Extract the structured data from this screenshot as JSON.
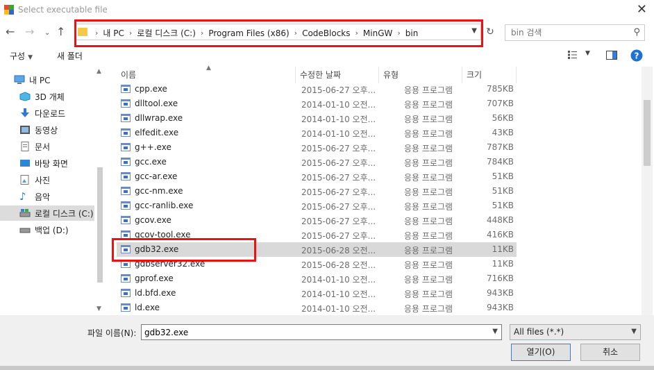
{
  "window": {
    "title": "Select executable file"
  },
  "address": {
    "crumbs": [
      "내 PC",
      "로컬 디스크 (C:)",
      "Program Files (x86)",
      "CodeBlocks",
      "MinGW",
      "bin"
    ]
  },
  "search": {
    "placeholder": "bin 검색"
  },
  "toolbar": {
    "organize_label": "구성",
    "new_folder_label": "새 폴더"
  },
  "sidebar": {
    "items": [
      {
        "label": "내 PC",
        "icon": "pc-icon"
      },
      {
        "label": "3D 개체",
        "icon": "cube-icon"
      },
      {
        "label": "다운로드",
        "icon": "download-icon"
      },
      {
        "label": "동영상",
        "icon": "video-icon"
      },
      {
        "label": "문서",
        "icon": "document-icon"
      },
      {
        "label": "바탕 화면",
        "icon": "desktop-icon"
      },
      {
        "label": "사진",
        "icon": "picture-icon"
      },
      {
        "label": "음악",
        "icon": "music-icon"
      },
      {
        "label": "로컬 디스크 (C:)",
        "icon": "drive-icon"
      },
      {
        "label": "백업 (D:)",
        "icon": "drive-icon"
      }
    ],
    "selected": "로컬 디스크 (C:)"
  },
  "columns": {
    "name": "이름",
    "date": "수정한 날짜",
    "type": "유형",
    "size": "크기"
  },
  "files": [
    {
      "name": "cpp.exe",
      "date": "2015-06-27 오후...",
      "type": "응용 프로그램",
      "size": "785KB"
    },
    {
      "name": "dlltool.exe",
      "date": "2014-01-10 오전...",
      "type": "응용 프로그램",
      "size": "707KB"
    },
    {
      "name": "dllwrap.exe",
      "date": "2014-01-10 오전...",
      "type": "응용 프로그램",
      "size": "56KB"
    },
    {
      "name": "elfedit.exe",
      "date": "2014-01-10 오전...",
      "type": "응용 프로그램",
      "size": "43KB"
    },
    {
      "name": "g++.exe",
      "date": "2015-06-27 오후...",
      "type": "응용 프로그램",
      "size": "787KB"
    },
    {
      "name": "gcc.exe",
      "date": "2015-06-27 오후...",
      "type": "응용 프로그램",
      "size": "784KB"
    },
    {
      "name": "gcc-ar.exe",
      "date": "2015-06-27 오후...",
      "type": "응용 프로그램",
      "size": "51KB"
    },
    {
      "name": "gcc-nm.exe",
      "date": "2015-06-27 오후...",
      "type": "응용 프로그램",
      "size": "51KB"
    },
    {
      "name": "gcc-ranlib.exe",
      "date": "2015-06-27 오후...",
      "type": "응용 프로그램",
      "size": "51KB"
    },
    {
      "name": "gcov.exe",
      "date": "2015-06-27 오후...",
      "type": "응용 프로그램",
      "size": "448KB"
    },
    {
      "name": "gcov-tool.exe",
      "date": "2015-06-27 오후...",
      "type": "응용 프로그램",
      "size": "416KB"
    },
    {
      "name": "gdb32.exe",
      "date": "2015-06-28 오전...",
      "type": "응용 프로그램",
      "size": "11KB"
    },
    {
      "name": "gdbserver32.exe",
      "date": "2015-06-28 오전...",
      "type": "응용 프로그램",
      "size": "11KB"
    },
    {
      "name": "gprof.exe",
      "date": "2014-01-10 오전...",
      "type": "응용 프로그램",
      "size": "716KB"
    },
    {
      "name": "ld.bfd.exe",
      "date": "2014-01-10 오전...",
      "type": "응용 프로그램",
      "size": "943KB"
    },
    {
      "name": "ld.exe",
      "date": "2014-01-10 오전...",
      "type": "응용 프로그램",
      "size": "943KB"
    }
  ],
  "selected_file": "gdb32.exe",
  "bottom": {
    "filename_label": "파일 이름(N):",
    "filename_value": "gdb32.exe",
    "filter_value": "All files (*.*)",
    "open_label": "열기(O)",
    "cancel_label": "취소"
  },
  "colors": {
    "highlight_border": "#e11111",
    "selection_bg": "#d9d9d9",
    "help_blue": "#1e72d2"
  }
}
